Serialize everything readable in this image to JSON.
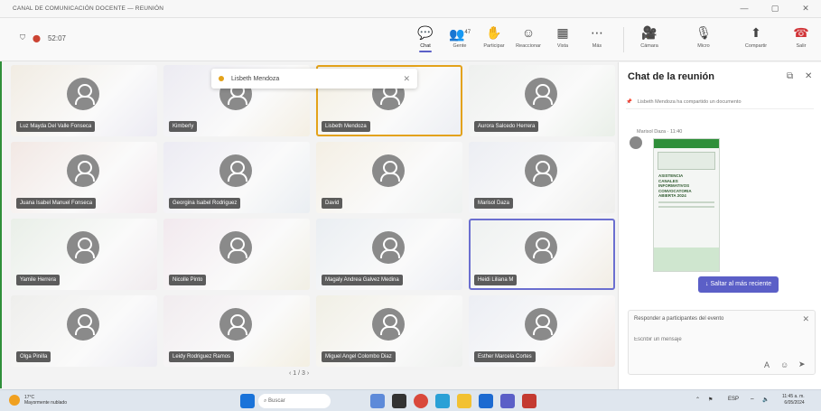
{
  "window": {
    "title": "CANAL DE COMUNICACIÓN DOCENTE — REUNIÓN",
    "minimize": "—",
    "maximize": "▢",
    "close": "✕"
  },
  "meeting": {
    "time": "52:07"
  },
  "toolbar": {
    "chat": "Chat",
    "people": "Gente",
    "raise": "Participar",
    "react": "Reaccionar",
    "view": "Vista",
    "more": "Más",
    "camera": "Cámara",
    "mic": "Micro",
    "share": "Compartir",
    "leave": "Salir",
    "people_count": "47"
  },
  "tiles": [
    {
      "name": "Luz Mayda Del Valle Fonseca"
    },
    {
      "name": "Kimberly"
    },
    {
      "name": "Lisbeth Mendoza"
    },
    {
      "name": "Aurora Salcedo Herrera"
    },
    {
      "name": "Juana Isabel Manuel Fonseca"
    },
    {
      "name": "Georgina Isabel Rodriguez"
    },
    {
      "name": "David"
    },
    {
      "name": "Marisol Daza"
    },
    {
      "name": "Yamile Herrera"
    },
    {
      "name": "Nicolle Pinto"
    },
    {
      "name": "Magaly Andrea Galvez Medina"
    },
    {
      "name": "Heidi Liliana M"
    },
    {
      "name": "Olga Pinilla"
    },
    {
      "name": "Leidy Rodriguez Ramos"
    },
    {
      "name": "Miguel Angel Colombo Diaz"
    },
    {
      "name": "Esther Marcela Cortes"
    }
  ],
  "toast": {
    "name": "Lisbeth Mendoza",
    "close": "✕"
  },
  "pager": {
    "label": "1 / 3"
  },
  "chat": {
    "title": "Chat de la reunión",
    "pinned": "Lisbeth Mendoza ha compartido un documento",
    "sender": "Marisol Daza · 11:40",
    "doc_lines": [
      "ASISTENCIA",
      "CANALES",
      "INFORMATIVOS",
      "CONVOCATORIA",
      "ABIERTA 2024"
    ],
    "jump": "Saltar al más reciente",
    "reply_title": "Responder a participantes del evento",
    "reply_placeholder": "Escribir un mensaje"
  },
  "taskbar": {
    "weather_temp": "17°C",
    "weather_desc": "Mayormente nublado",
    "search": "Buscar",
    "lang": "ESP",
    "clock_time": "11:45 a. m.",
    "clock_date": "6/05/2024"
  }
}
